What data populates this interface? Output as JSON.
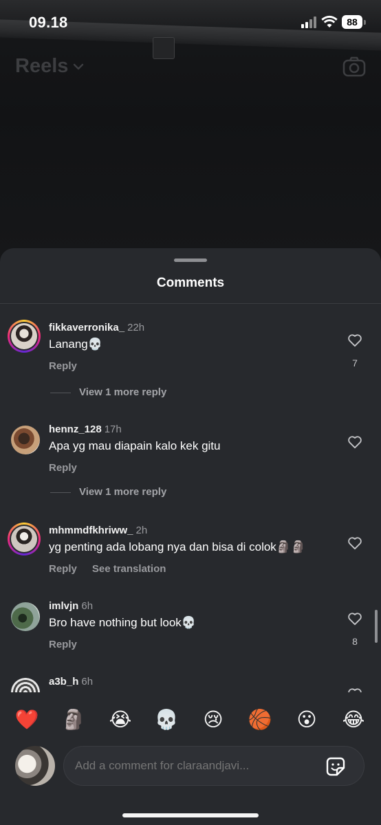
{
  "status": {
    "time": "09.18",
    "battery": "88"
  },
  "header": {
    "title": "Reels",
    "chevron_icon": "chevron-down-icon",
    "camera_icon": "camera-icon"
  },
  "sheet": {
    "title": "Comments"
  },
  "comments": [
    {
      "user": "fikkaverronika_",
      "ago": "22h",
      "text": "Lanang💀",
      "reply": "Reply",
      "likes": "7",
      "view_more": "View 1 more reply"
    },
    {
      "user": "hennz_128",
      "ago": "17h",
      "text": "Apa yg mau diapain kalo kek gitu",
      "reply": "Reply",
      "view_more": "View 1 more reply"
    },
    {
      "user": "mhmmdfkhriww_",
      "ago": "2h",
      "text": "yg penting ada lobang nya dan bisa di colok🗿🗿",
      "reply": "Reply",
      "translate": "See translation"
    },
    {
      "user": "imlvjn",
      "ago": "6h",
      "text": "Bro have nothing but look💀",
      "reply": "Reply",
      "likes": "8"
    },
    {
      "user": "a3b_h",
      "ago": "6h"
    }
  ],
  "reactions": [
    "❤️",
    "🗿",
    "😭",
    "💀",
    "😢",
    "🏀",
    "😮",
    "😂"
  ],
  "composer": {
    "placeholder": "Add a comment for claraandjavi...",
    "sticker_icon": "sticker-icon"
  },
  "colors": {
    "sheet_bg": "#27292d",
    "muted_text": "#9a9b9f",
    "ring_gradient": [
      "#f9ce34",
      "#ee2a7b",
      "#6228d7"
    ]
  }
}
